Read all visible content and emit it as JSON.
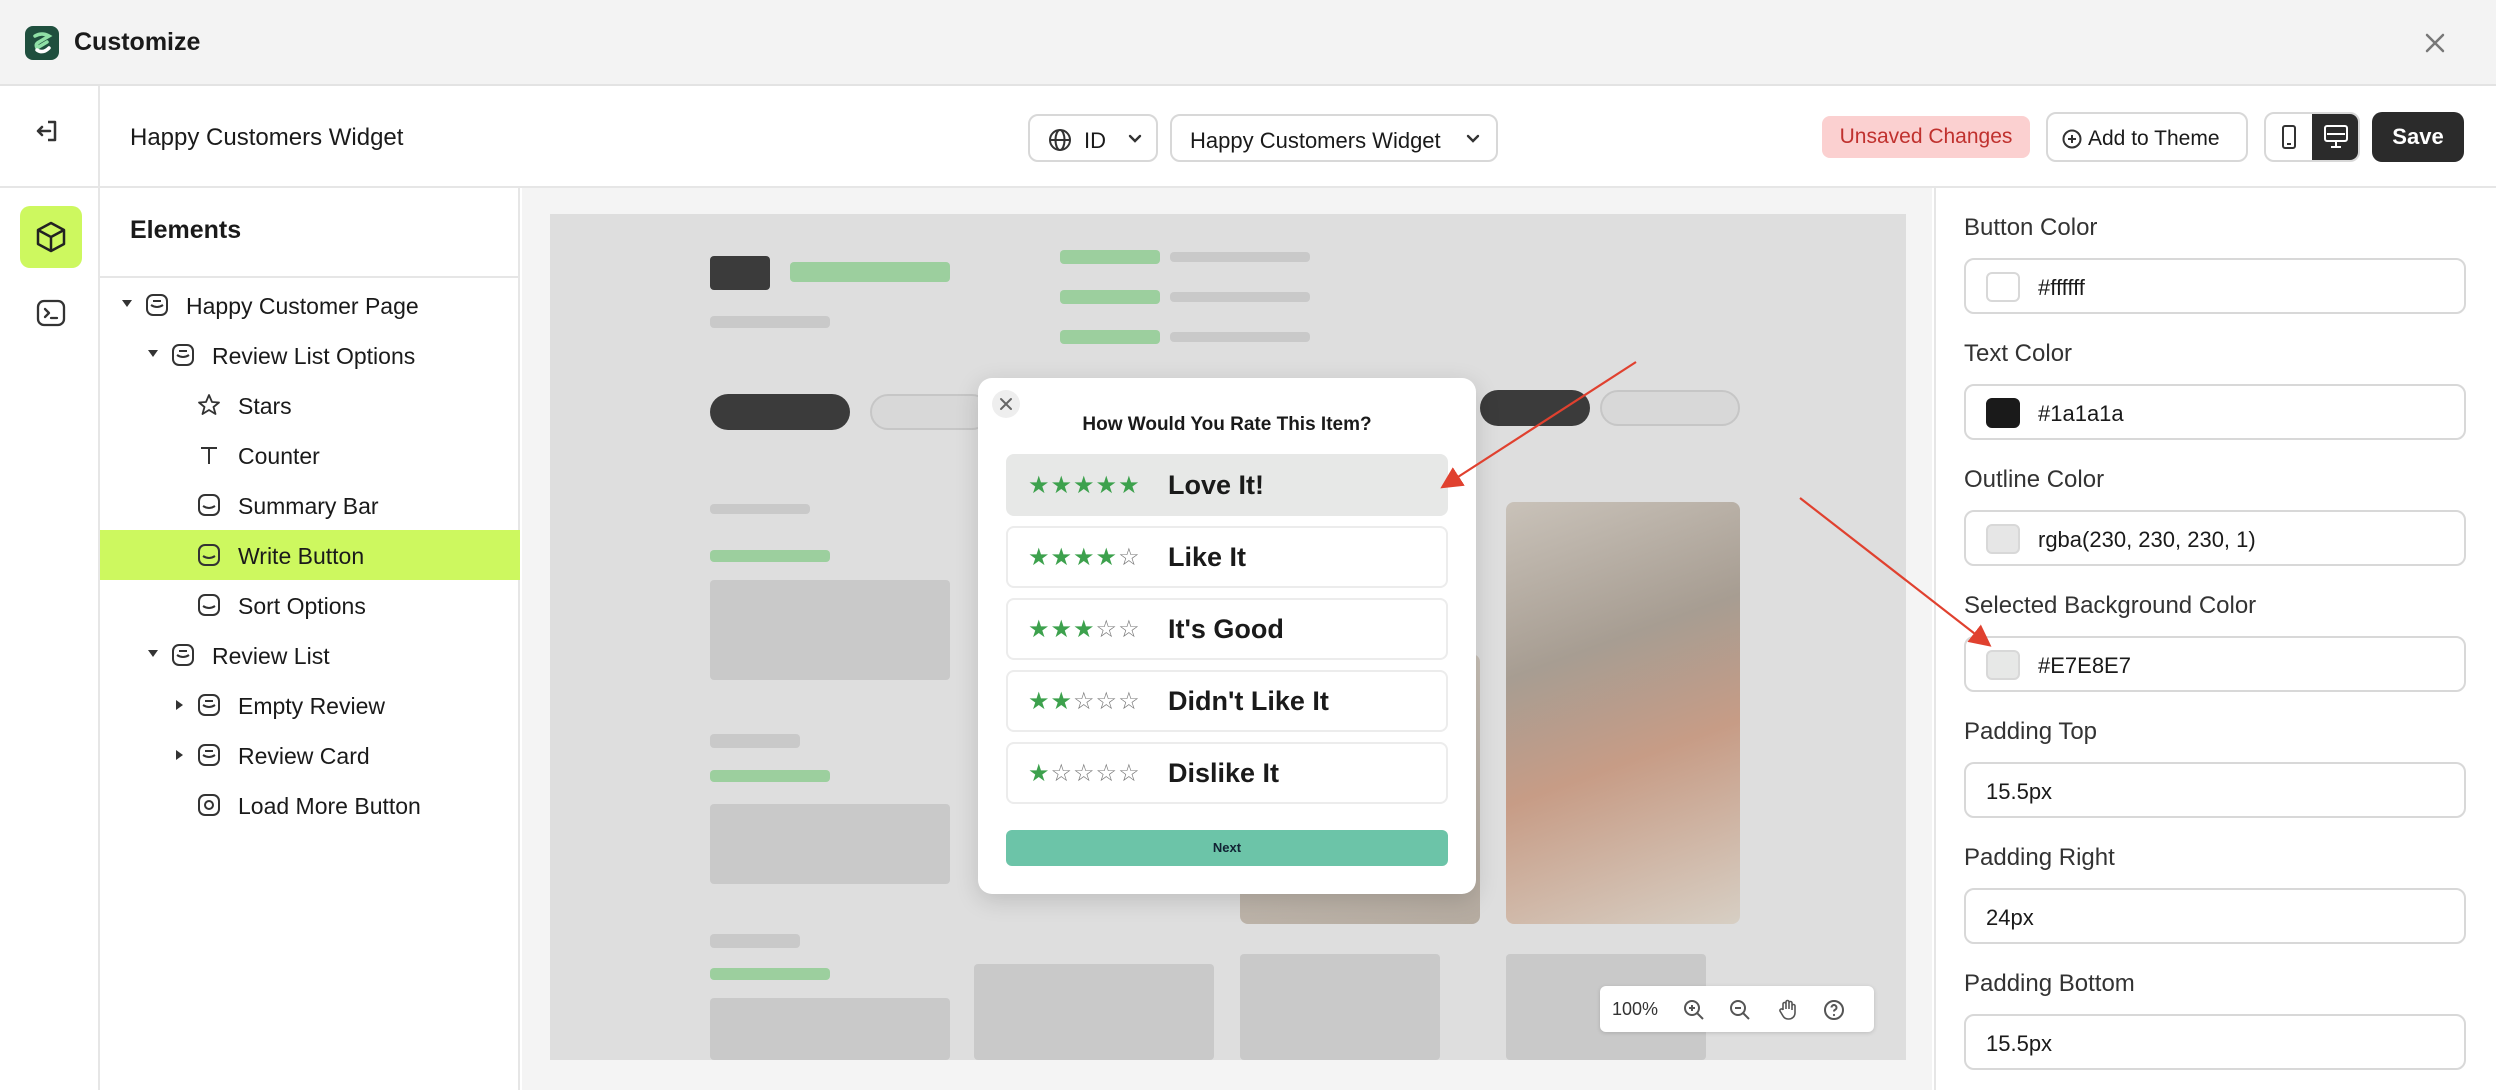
{
  "app": {
    "title": "Customize"
  },
  "header": {
    "page_name": "Happy Customers Widget",
    "language": "ID",
    "page_select": "Happy Customers Widget",
    "unsaved": "Unsaved Changes",
    "add_to_theme": "Add to Theme",
    "save": "Save"
  },
  "tree": {
    "title": "Elements",
    "items": [
      {
        "label": "Happy Customer Page",
        "icon": "section-icon"
      },
      {
        "label": "Review List Options",
        "icon": "section-icon"
      },
      {
        "label": "Stars",
        "icon": "star-icon"
      },
      {
        "label": "Counter",
        "icon": "text-icon"
      },
      {
        "label": "Summary Bar",
        "icon": "block-icon"
      },
      {
        "label": "Write Button",
        "icon": "block-icon",
        "selected": true
      },
      {
        "label": "Sort Options",
        "icon": "block-icon"
      },
      {
        "label": "Review List",
        "icon": "section-icon"
      },
      {
        "label": "Empty Review",
        "icon": "section-icon"
      },
      {
        "label": "Review Card",
        "icon": "section-icon"
      },
      {
        "label": "Load More Button",
        "icon": "button-icon"
      }
    ]
  },
  "preview": {
    "modal": {
      "title": "How Would You Rate This Item?",
      "options": [
        {
          "label": "Love It!",
          "stars": 5,
          "selected": true
        },
        {
          "label": "Like It",
          "stars": 4
        },
        {
          "label": "It's Good",
          "stars": 3
        },
        {
          "label": "Didn't Like It",
          "stars": 2
        },
        {
          "label": "Dislike It",
          "stars": 1
        }
      ],
      "next": "Next"
    },
    "zoom": "100%"
  },
  "properties": {
    "button_color": {
      "label": "Button Color",
      "value": "#ffffff"
    },
    "text_color": {
      "label": "Text Color",
      "value": "#1a1a1a"
    },
    "outline_color": {
      "label": "Outline Color",
      "value": "rgba(230, 230, 230, 1)"
    },
    "selected_bg": {
      "label": "Selected Background Color",
      "value": "#E7E8E7"
    },
    "padding_top": {
      "label": "Padding Top",
      "value": "15.5px"
    },
    "padding_right": {
      "label": "Padding Right",
      "value": "24px"
    },
    "padding_bottom": {
      "label": "Padding Bottom",
      "value": "15.5px"
    }
  },
  "colors": {
    "accent": "#cdf85f",
    "star": "#3da14d",
    "arrow": "#e0412f",
    "unsaved_bg": "#fbd0d0",
    "unsaved_text": "#c0312e"
  }
}
